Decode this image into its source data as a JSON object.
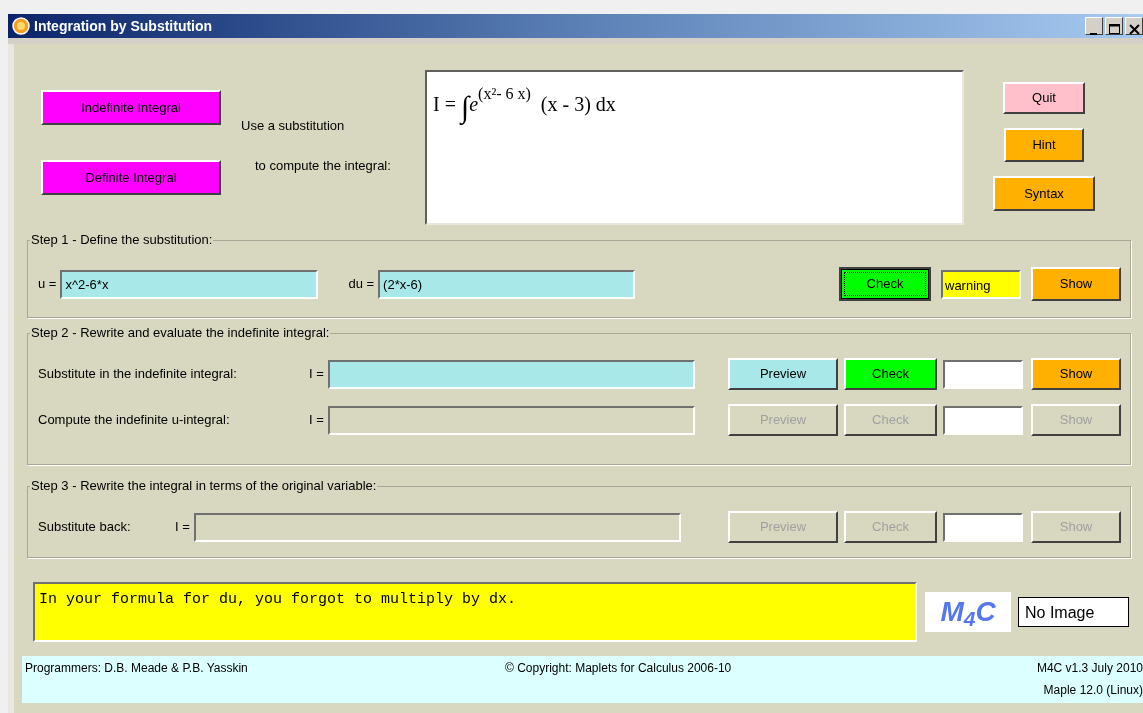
{
  "window": {
    "title": "Integration by Substitution"
  },
  "top_buttons": [
    {
      "label": "Indefinite Integral",
      "color": "#ff00ff"
    },
    {
      "label": "Definite Integral",
      "color": "#ff00ff"
    }
  ],
  "prompt": [
    "Use a substitution",
    "to compute the integral:"
  ],
  "integral": {
    "lhs": "I =",
    "sign": "∫",
    "base": "e",
    "exponent": "(x²- 6 x)",
    "factor": "(x - 3)",
    "differential": "dx"
  },
  "side_buttons": [
    {
      "label": "Quit",
      "color": "#ffc0cb"
    },
    {
      "label": "Hint",
      "color": "#ffb000"
    },
    {
      "label": "Syntax",
      "color": "#ffb000"
    }
  ],
  "step1": {
    "title": "Step 1 - Define the substitution:",
    "fields": [
      {
        "label": "u =",
        "value": "x^2-6*x"
      },
      {
        "label": "du =",
        "value": "(2*x-6)"
      }
    ],
    "check": {
      "label": "Check",
      "focused": true
    },
    "status": {
      "text": "warning",
      "color": "#ffff00"
    },
    "show": "Show"
  },
  "step2": {
    "title": "Step 2 - Rewrite and evaluate the indefinite integral:",
    "rows": [
      {
        "label": "Substitute in the indefinite integral:",
        "eq": "I =",
        "enabled": true,
        "preview": "Preview",
        "check": "Check",
        "show": "Show"
      },
      {
        "label": "Compute the indefinite u-integral:",
        "eq": "I =",
        "enabled": false,
        "preview": "Preview",
        "check": "Check",
        "show": "Show"
      }
    ]
  },
  "step3": {
    "title": "Step 3 - Rewrite the integral in terms of the original variable:",
    "rows": [
      {
        "label": "Substitute back:",
        "eq": "I =",
        "enabled": false,
        "preview": "Preview",
        "check": "Check",
        "show": "Show"
      }
    ]
  },
  "message": "In your formula for du, you forgot to multiply by dx.",
  "logo": "M$_{4}$C",
  "image_box": "No Image",
  "footer": {
    "left": "Programmers: D.B. Meade & P.B. Yasskin",
    "center": "© Copyright: Maplets for Calculus 2006-10",
    "right": [
      "M4C v1.3 July 2010",
      "Maple 12.0 (Linux)"
    ]
  }
}
